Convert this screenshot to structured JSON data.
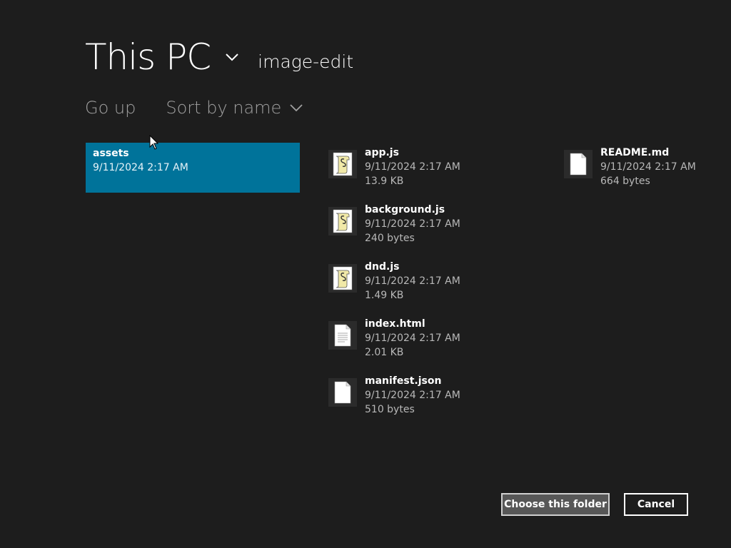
{
  "header": {
    "location": "This PC",
    "folder": "image-edit"
  },
  "commands": {
    "go_up": "Go up",
    "sort": "Sort by name"
  },
  "folders": [
    {
      "name": "assets",
      "date": "9/11/2024 2:17 AM"
    }
  ],
  "files": [
    {
      "name": "app.js",
      "date": "9/11/2024 2:17 AM",
      "size": "13.9 KB",
      "icon": "script-file-icon"
    },
    {
      "name": "background.js",
      "date": "9/11/2024 2:17 AM",
      "size": "240 bytes",
      "icon": "script-file-icon"
    },
    {
      "name": "dnd.js",
      "date": "9/11/2024 2:17 AM",
      "size": "1.49 KB",
      "icon": "script-file-icon"
    },
    {
      "name": "index.html",
      "date": "9/11/2024 2:17 AM",
      "size": "2.01 KB",
      "icon": "text-document-icon"
    },
    {
      "name": "manifest.json",
      "date": "9/11/2024 2:17 AM",
      "size": "510 bytes",
      "icon": "blank-document-icon"
    },
    {
      "name": "README.md",
      "date": "9/11/2024 2:17 AM",
      "size": "664 bytes",
      "icon": "blank-document-icon"
    }
  ],
  "buttons": {
    "choose": "Choose this folder",
    "cancel": "Cancel"
  },
  "colors": {
    "background": "#1d1d1d",
    "selected_tile": "#00739a"
  }
}
